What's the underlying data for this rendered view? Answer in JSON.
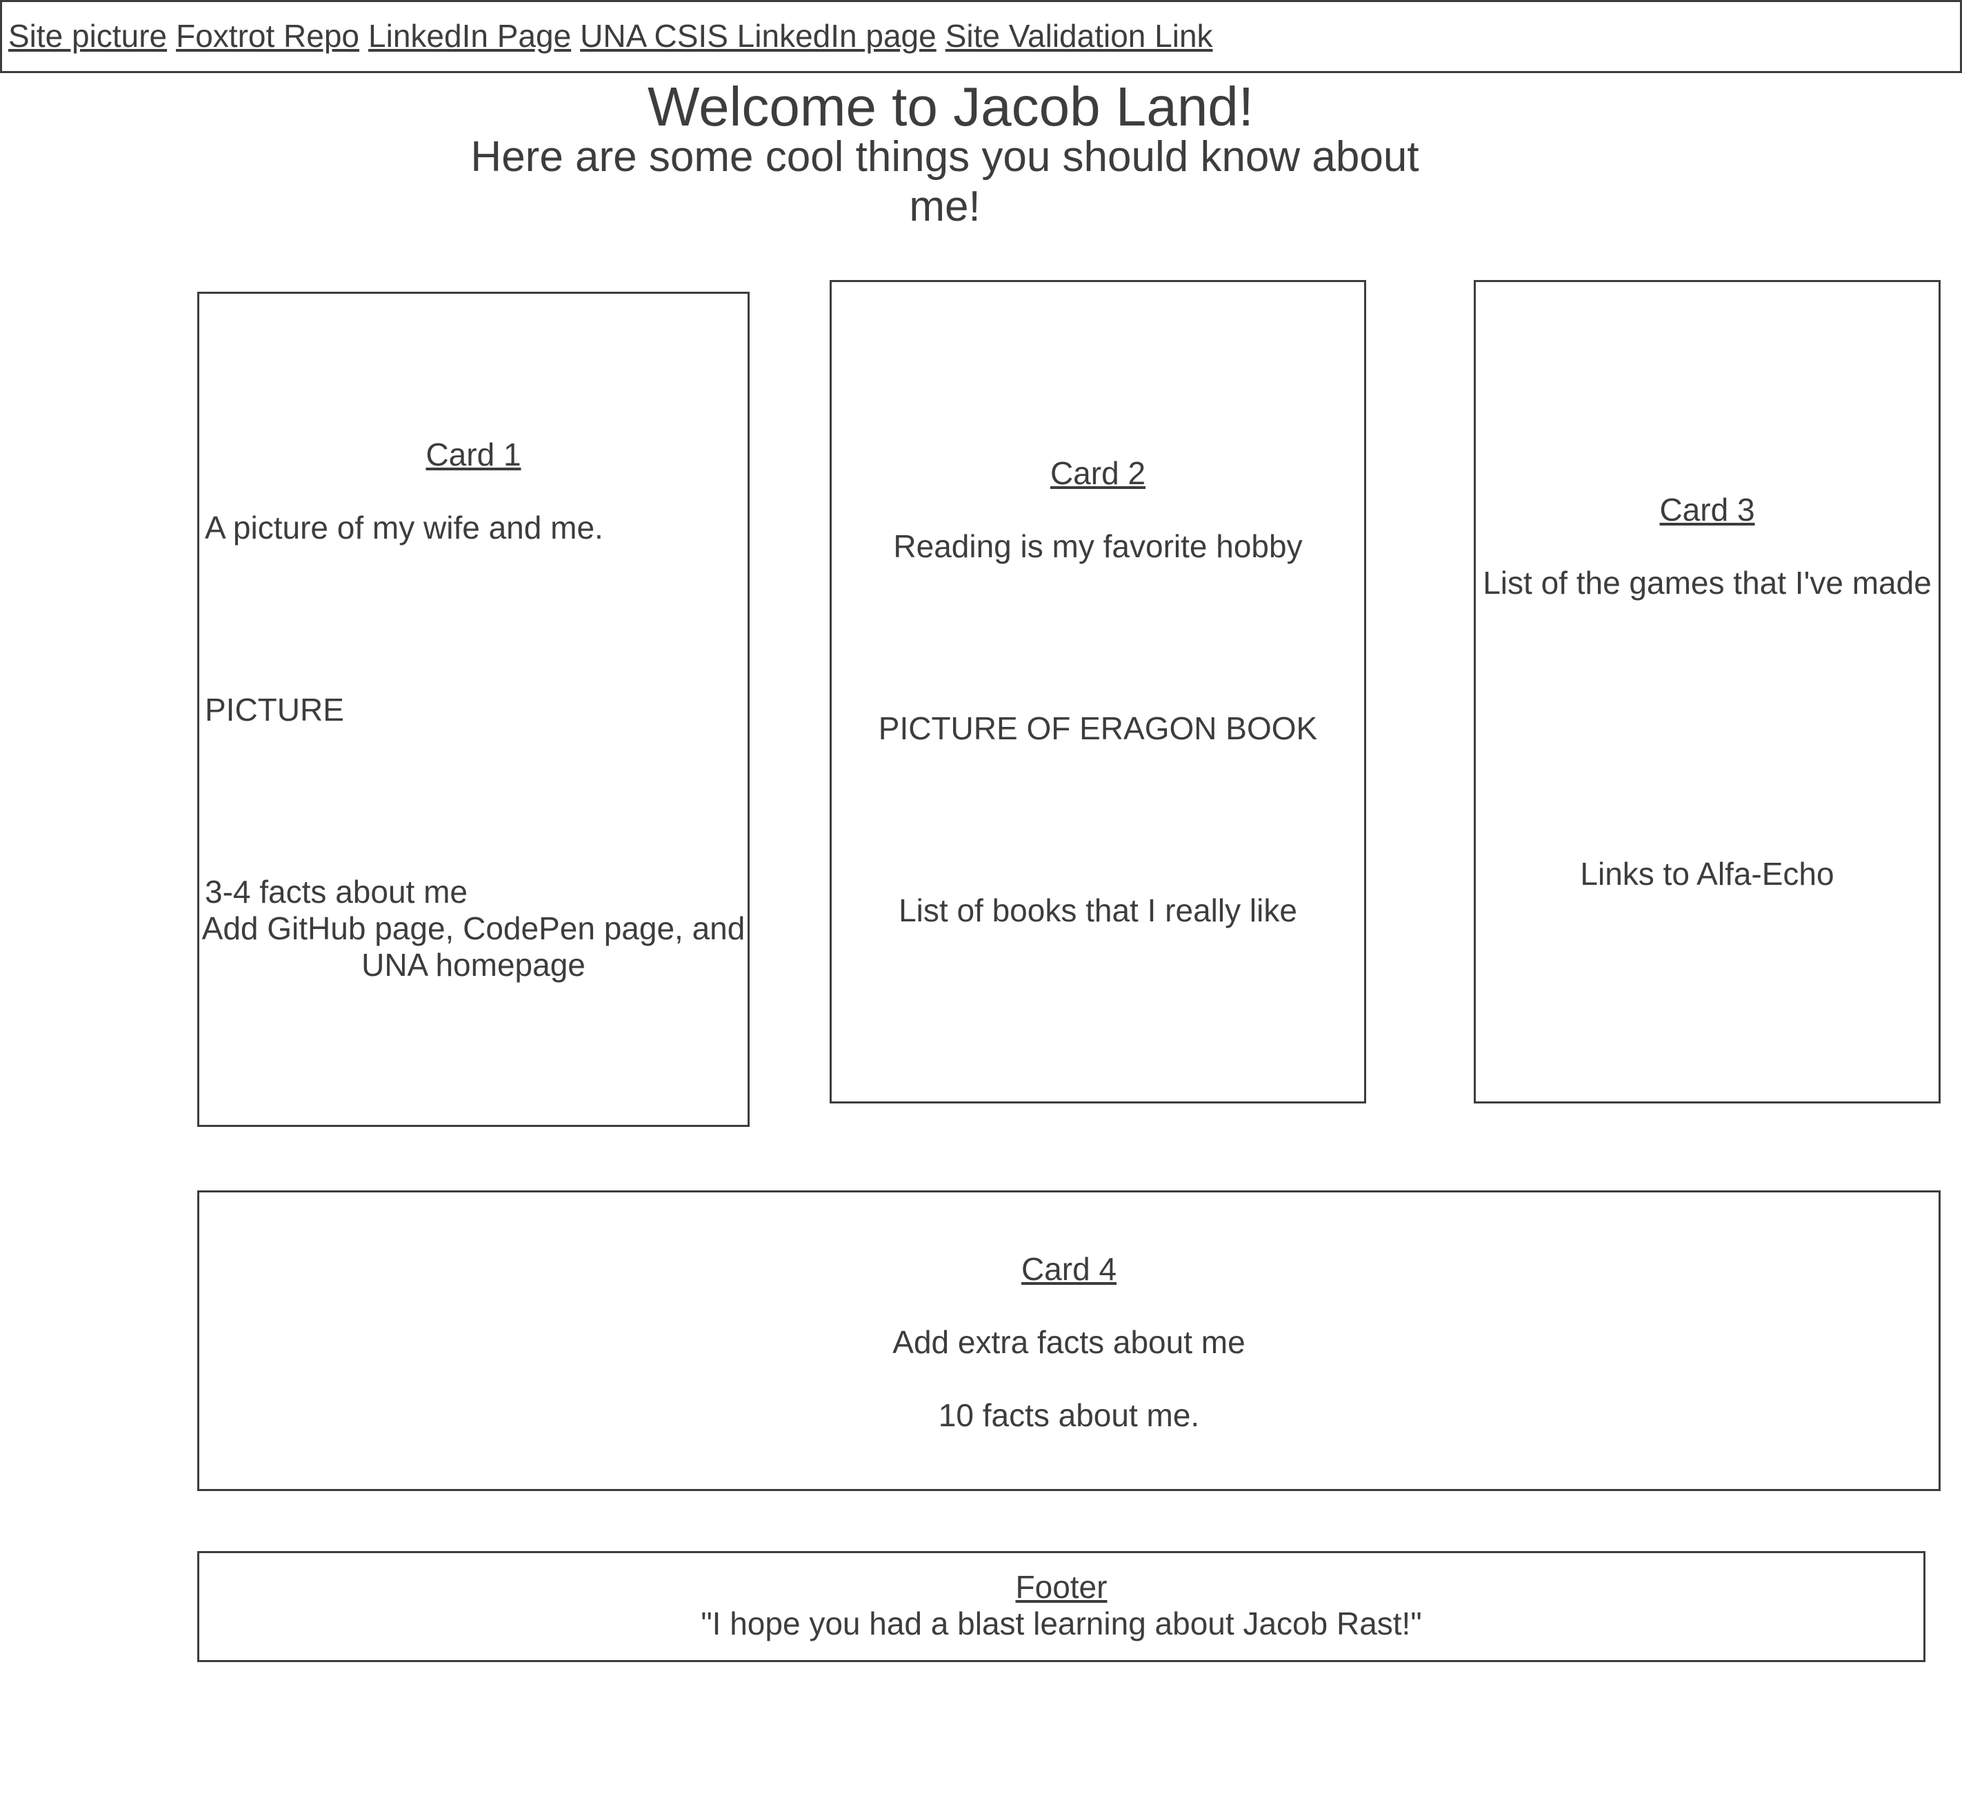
{
  "nav": {
    "links": [
      "Site picture",
      "Foxtrot Repo",
      "LinkedIn Page",
      "UNA CSIS LinkedIn page",
      "Site Validation Link"
    ]
  },
  "header": {
    "title": "Welcome to Jacob Land!",
    "subtitle_line1": "Here are some cool things you should know about",
    "subtitle_line2": "me!"
  },
  "cards": [
    {
      "title": "Card 1",
      "text1": "A picture of my wife and me.",
      "text2": "PICTURE",
      "text3": "3-4 facts about me",
      "text4_line1": "Add GitHub page, CodePen page, and",
      "text4_line2": "UNA homepage"
    },
    {
      "title": "Card 2",
      "text1": "Reading is my favorite hobby",
      "text2": "PICTURE OF ERAGON BOOK",
      "text3": "List of books that I really like"
    },
    {
      "title": "Card 3",
      "text1": "List of the games that I've made",
      "text2": "Links to Alfa-Echo"
    },
    {
      "title": "Card 4",
      "text1": "Add extra facts about me",
      "text2": "10 facts about me."
    }
  ],
  "footer": {
    "title": "Footer",
    "quote": "\"I hope you had a blast learning about Jacob Rast!\""
  }
}
